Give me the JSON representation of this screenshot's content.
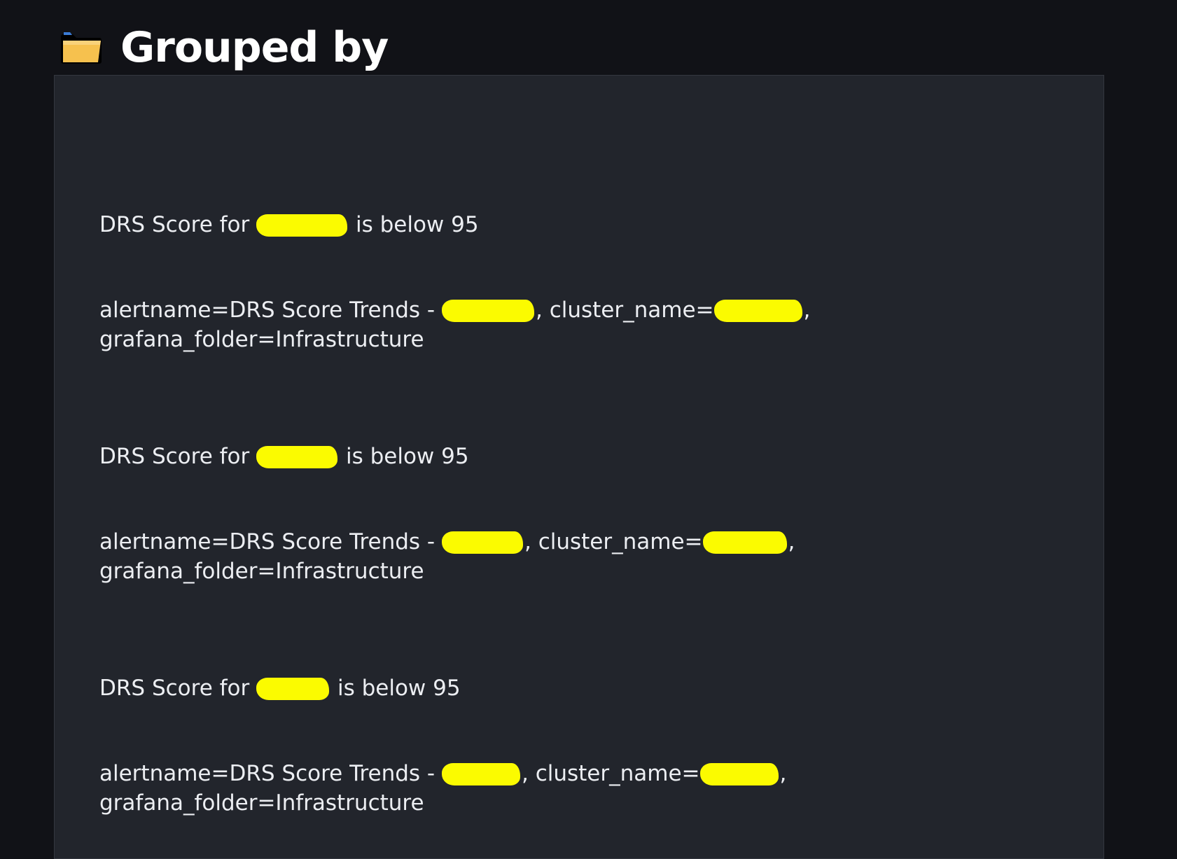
{
  "header": {
    "title": "Grouped by",
    "icon": "folder-icon",
    "icon_color": "#f6c14e"
  },
  "colors": {
    "page_background": "#111217",
    "panel_background": "#22252c",
    "redaction": "#fbfb00"
  },
  "groups": [
    {
      "summary_prefix": "DRS Score for",
      "summary_suffix": "is below 95",
      "labels_prefix": "alertname=DRS Score Trends -",
      "labels_middle": ", cluster_name=",
      "labels_comma": ",",
      "labels_line2": "grafana_folder=Infrastructure"
    },
    {
      "summary_prefix": "DRS Score for",
      "summary_suffix": "is below 95",
      "labels_prefix": "alertname=DRS Score Trends -",
      "labels_middle": ", cluster_name=",
      "labels_comma": ",",
      "labels_line2": "grafana_folder=Infrastructure"
    },
    {
      "summary_prefix": "DRS Score for",
      "summary_suffix": "is below 95",
      "labels_prefix": "alertname=DRS Score Trends -",
      "labels_middle": ", cluster_name=",
      "labels_comma": ",",
      "labels_line2": "grafana_folder=Infrastructure"
    }
  ]
}
